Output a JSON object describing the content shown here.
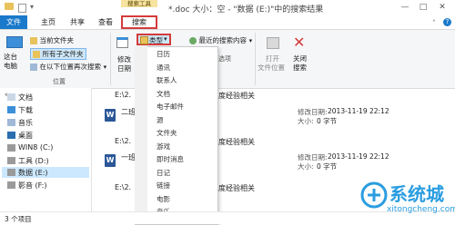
{
  "titlebar": {
    "context_tab_label": "搜索工具",
    "window_title": "*.doc 大小：空 - \"数据 (E:)\"中的搜索结果",
    "minimize": "—",
    "maximize": "□",
    "close": "✕"
  },
  "tabs": {
    "file": "文件",
    "home": "主页",
    "share": "共享",
    "view": "查看",
    "search": "搜索"
  },
  "ribbon": {
    "this_pc": "这台电脑",
    "current_folder": "当前文件夹",
    "all_subfolders": "所有子文件夹",
    "search_again_in": "在以下位置再次搜索",
    "location_group": "位置",
    "date_modified_line1": "修改",
    "date_modified_line2": "日期",
    "type_button": "类型",
    "recent_searches": "最近的搜索内容",
    "options_label": "选项",
    "open_location_line1": "打开",
    "open_location_line2": "文件位置",
    "close_search_line1": "关闭",
    "close_search_line2": "搜索"
  },
  "nav": {
    "items": [
      {
        "label": "文档",
        "icon": "documents-icon"
      },
      {
        "label": "下载",
        "icon": "downloads-icon"
      },
      {
        "label": "音乐",
        "icon": "music-icon"
      },
      {
        "label": "桌面",
        "icon": "desktop-icon"
      },
      {
        "label": "WIN8 (C:)",
        "icon": "drive-icon"
      },
      {
        "label": "工具 (D:)",
        "icon": "drive-icon"
      },
      {
        "label": "数据 (E:)",
        "icon": "drive-icon"
      },
      {
        "label": "影音 (F:)",
        "icon": "drive-icon"
      }
    ]
  },
  "results": [
    {
      "path_left": "E:\\2.",
      "path_right": "度经验相关",
      "title": "",
      "date_label": "",
      "date": "",
      "size_label": "",
      "size": ""
    },
    {
      "path_left": "",
      "path_right": "",
      "title": "二班",
      "date_label": "修改日期:",
      "date": "2013-11-19 22:12",
      "size_label": "大小:",
      "size": "0 字节"
    },
    {
      "path_left": "E:\\2.",
      "path_right": "度经验相关",
      "title": "",
      "date_label": "",
      "date": "",
      "size_label": "",
      "size": ""
    },
    {
      "path_left": "",
      "path_right": "",
      "title": "一班",
      "date_label": "修改日期:",
      "date": "2013-11-19 22:12",
      "size_label": "大小:",
      "size": "0 字节"
    },
    {
      "path_left": "E:\\2.",
      "path_right": "度经验相关",
      "title": "",
      "date_label": "",
      "date": "",
      "size_label": "",
      "size": ""
    }
  ],
  "type_dropdown": {
    "items": [
      "日历",
      "通讯",
      "联系人",
      "文档",
      "电子邮件",
      "源",
      "文件夹",
      "游戏",
      "即时消息",
      "日记",
      "链接",
      "电影",
      "音乐"
    ]
  },
  "status": {
    "item_count": "3 个项目"
  },
  "watermark": {
    "brand": "系统城",
    "url": "xitongcheng.com"
  },
  "colors": {
    "file_tab": "#1979ca",
    "highlight_border": "#d43c3c",
    "context_tab": "#f7e3a0"
  }
}
